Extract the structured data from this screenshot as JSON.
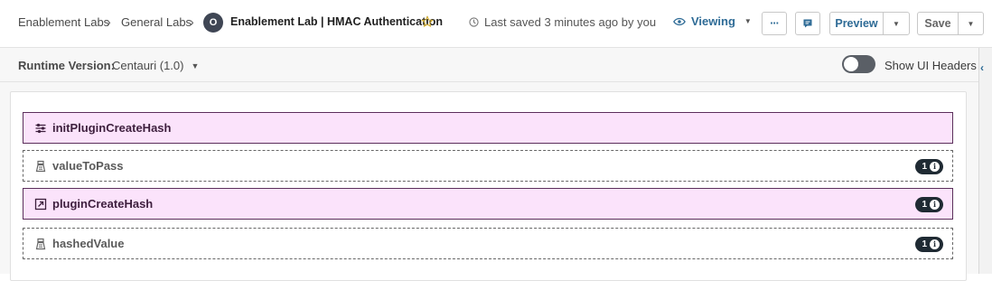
{
  "header": {
    "breadcrumbs": [
      "Enablement Labs",
      "General Labs"
    ],
    "avatar_initial": "O",
    "title": "Enablement Lab | HMAC Authentication",
    "saved_status": "Last saved 3 minutes ago by you",
    "view_mode": "Viewing",
    "more_label": "···",
    "preview_label": "Preview",
    "save_label": "Save"
  },
  "runtime": {
    "label": "Runtime Version:",
    "value": "Centauri (1.0)",
    "show_headers_label": "Show UI Headers",
    "show_headers_on": false
  },
  "steps": [
    {
      "label": "initPluginCreateHash",
      "style": "solid",
      "icon": "sliders-icon",
      "badge": ""
    },
    {
      "label": "valueToPass",
      "style": "dashed",
      "icon": "variable-icon",
      "badge": "1"
    },
    {
      "label": "pluginCreateHash",
      "style": "solid",
      "icon": "external-link-icon",
      "badge": "1"
    },
    {
      "label": "hashedValue",
      "style": "dashed",
      "icon": "variable-icon",
      "badge": "1"
    }
  ],
  "colors": {
    "accent": "#2e6b96",
    "step_fill": "#fbe3fb",
    "step_border": "#5b2f5b",
    "badge_bg": "#1f2a33",
    "star": "#d7b23a"
  }
}
